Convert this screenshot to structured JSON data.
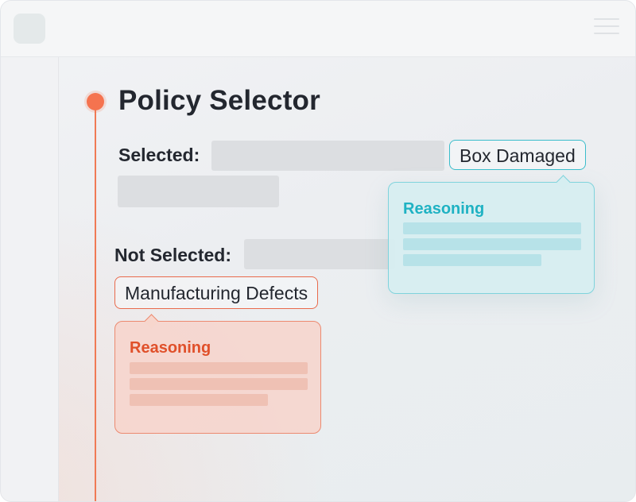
{
  "header": {
    "app_icon": "app-logo-placeholder",
    "menu_icon": "hamburger-menu-icon"
  },
  "main": {
    "title": "Policy Selector",
    "selected": {
      "label": "Selected:",
      "tag": "Box Damaged",
      "reasoning_title": "Reasoning"
    },
    "not_selected": {
      "label": "Not Selected:",
      "tag": "Manufacturing Defects",
      "reasoning_title": "Reasoning"
    }
  },
  "colors": {
    "accent_coral": "#f5734f",
    "accent_teal": "#3bbdcb",
    "text_dark": "#23272f"
  }
}
